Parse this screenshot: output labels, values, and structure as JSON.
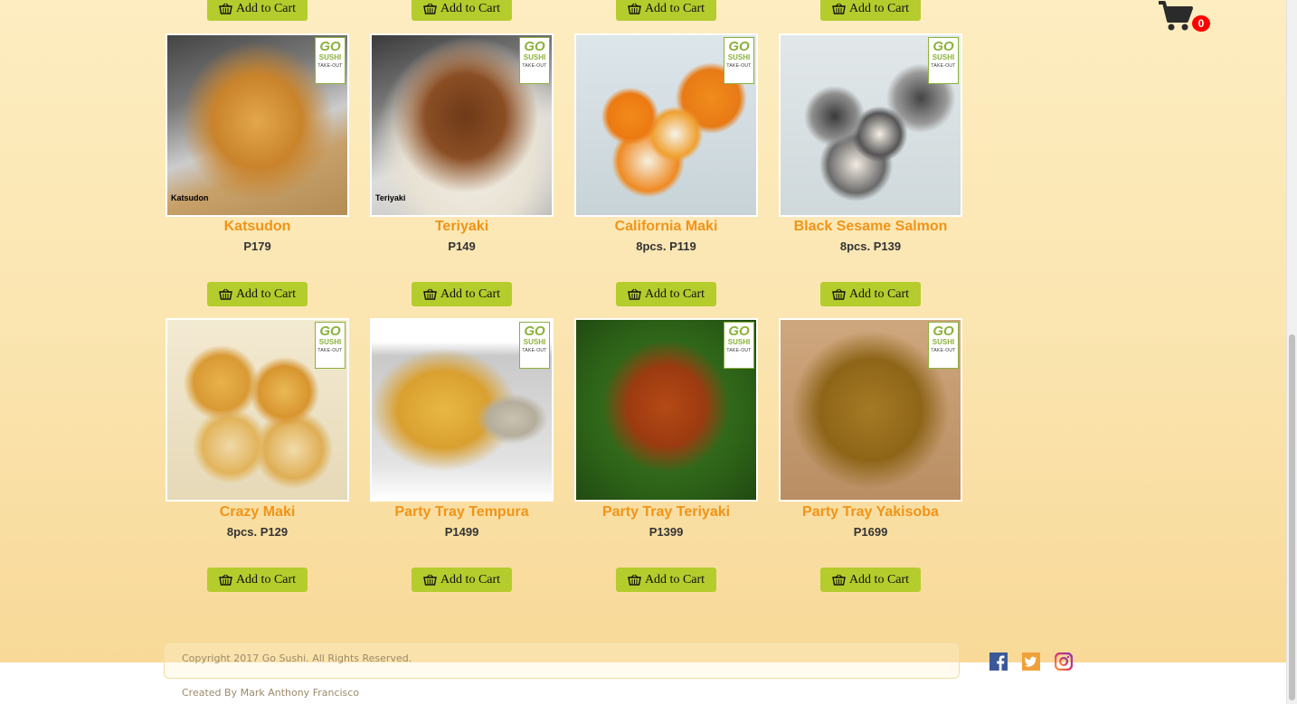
{
  "colors": {
    "accent": "#b5cc2d",
    "product_name": "#f09418",
    "badge": "#ff0000",
    "brand_green": "#8bb13a"
  },
  "add_to_cart_label": "Add to Cart",
  "cart": {
    "count": "0",
    "icon": "cart-icon"
  },
  "logo": {
    "line1": "GO",
    "line2": "SUSHI",
    "line3": "TAKE-OUT"
  },
  "products": [
    {
      "name": "Katsudon",
      "price": "P179",
      "caption": "Katsudon"
    },
    {
      "name": "Teriyaki",
      "price": "P149",
      "caption": "Teriyaki"
    },
    {
      "name": "California Maki",
      "price": "8pcs. P119",
      "caption": ""
    },
    {
      "name": "Black Sesame Salmon",
      "price": "8pcs. P139",
      "caption": ""
    },
    {
      "name": "Crazy Maki",
      "price": "8pcs. P129",
      "caption": ""
    },
    {
      "name": "Party Tray Tempura",
      "price": "P1499",
      "caption": ""
    },
    {
      "name": "Party Tray Teriyaki",
      "price": "P1399",
      "caption": ""
    },
    {
      "name": "Party Tray Yakisoba",
      "price": "P1699",
      "caption": ""
    }
  ],
  "footer": {
    "copyright": "Copyright 2017 Go Sushi. All Rights Reserved.",
    "creator": "Created By Mark Anthony Francisco"
  },
  "social": [
    "facebook-icon",
    "twitter-icon",
    "instagram-icon"
  ]
}
